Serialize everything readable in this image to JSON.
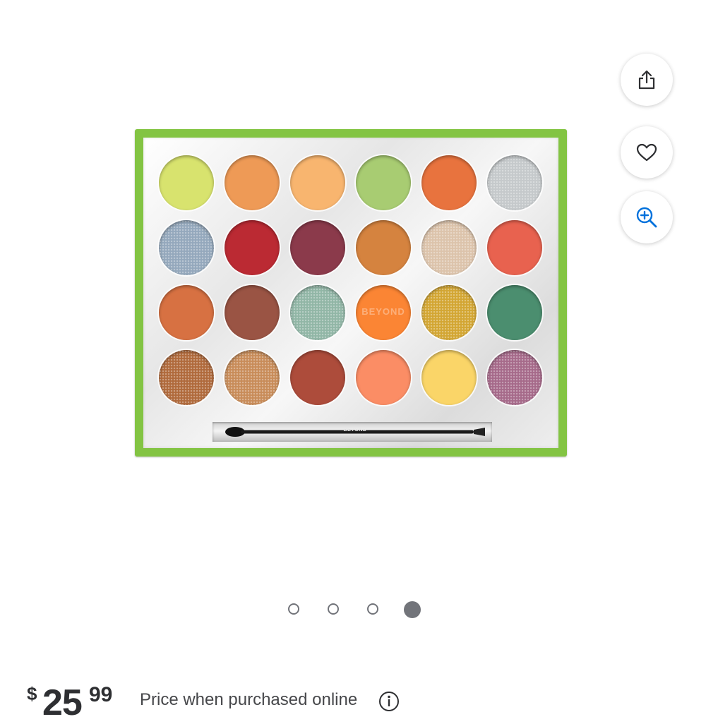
{
  "actions": {
    "share_icon": "share-icon",
    "favorite_icon": "heart-icon",
    "zoom_icon": "zoom-in-icon"
  },
  "product_image": {
    "frame_color": "#83c443",
    "pan_label": "BEYOND",
    "brush_label": "BEYOND",
    "shades": [
      [
        "#d8e36e",
        "#ee9a56",
        "#f8b56f",
        "#a8cc72",
        "#e8733e",
        "#c5c9cb"
      ],
      [
        "#94a8bc",
        "#bb2a33",
        "#8b3a4b",
        "#d5833f",
        "#dcc3ab",
        "#e8624f"
      ],
      [
        "#d77142",
        "#9a5444",
        "#91b6a6",
        "#fb8534",
        "#d3a633",
        "#4b8e6f"
      ],
      [
        "#b06a3c",
        "#c88c59",
        "#ad4c3b",
        "#fb8d65",
        "#fad568",
        "#a66a8a"
      ]
    ]
  },
  "carousel": {
    "count": 4,
    "active_index": 3
  },
  "price": {
    "currency": "$",
    "dollars": "25",
    "cents": "99",
    "note": "Price when purchased online"
  }
}
